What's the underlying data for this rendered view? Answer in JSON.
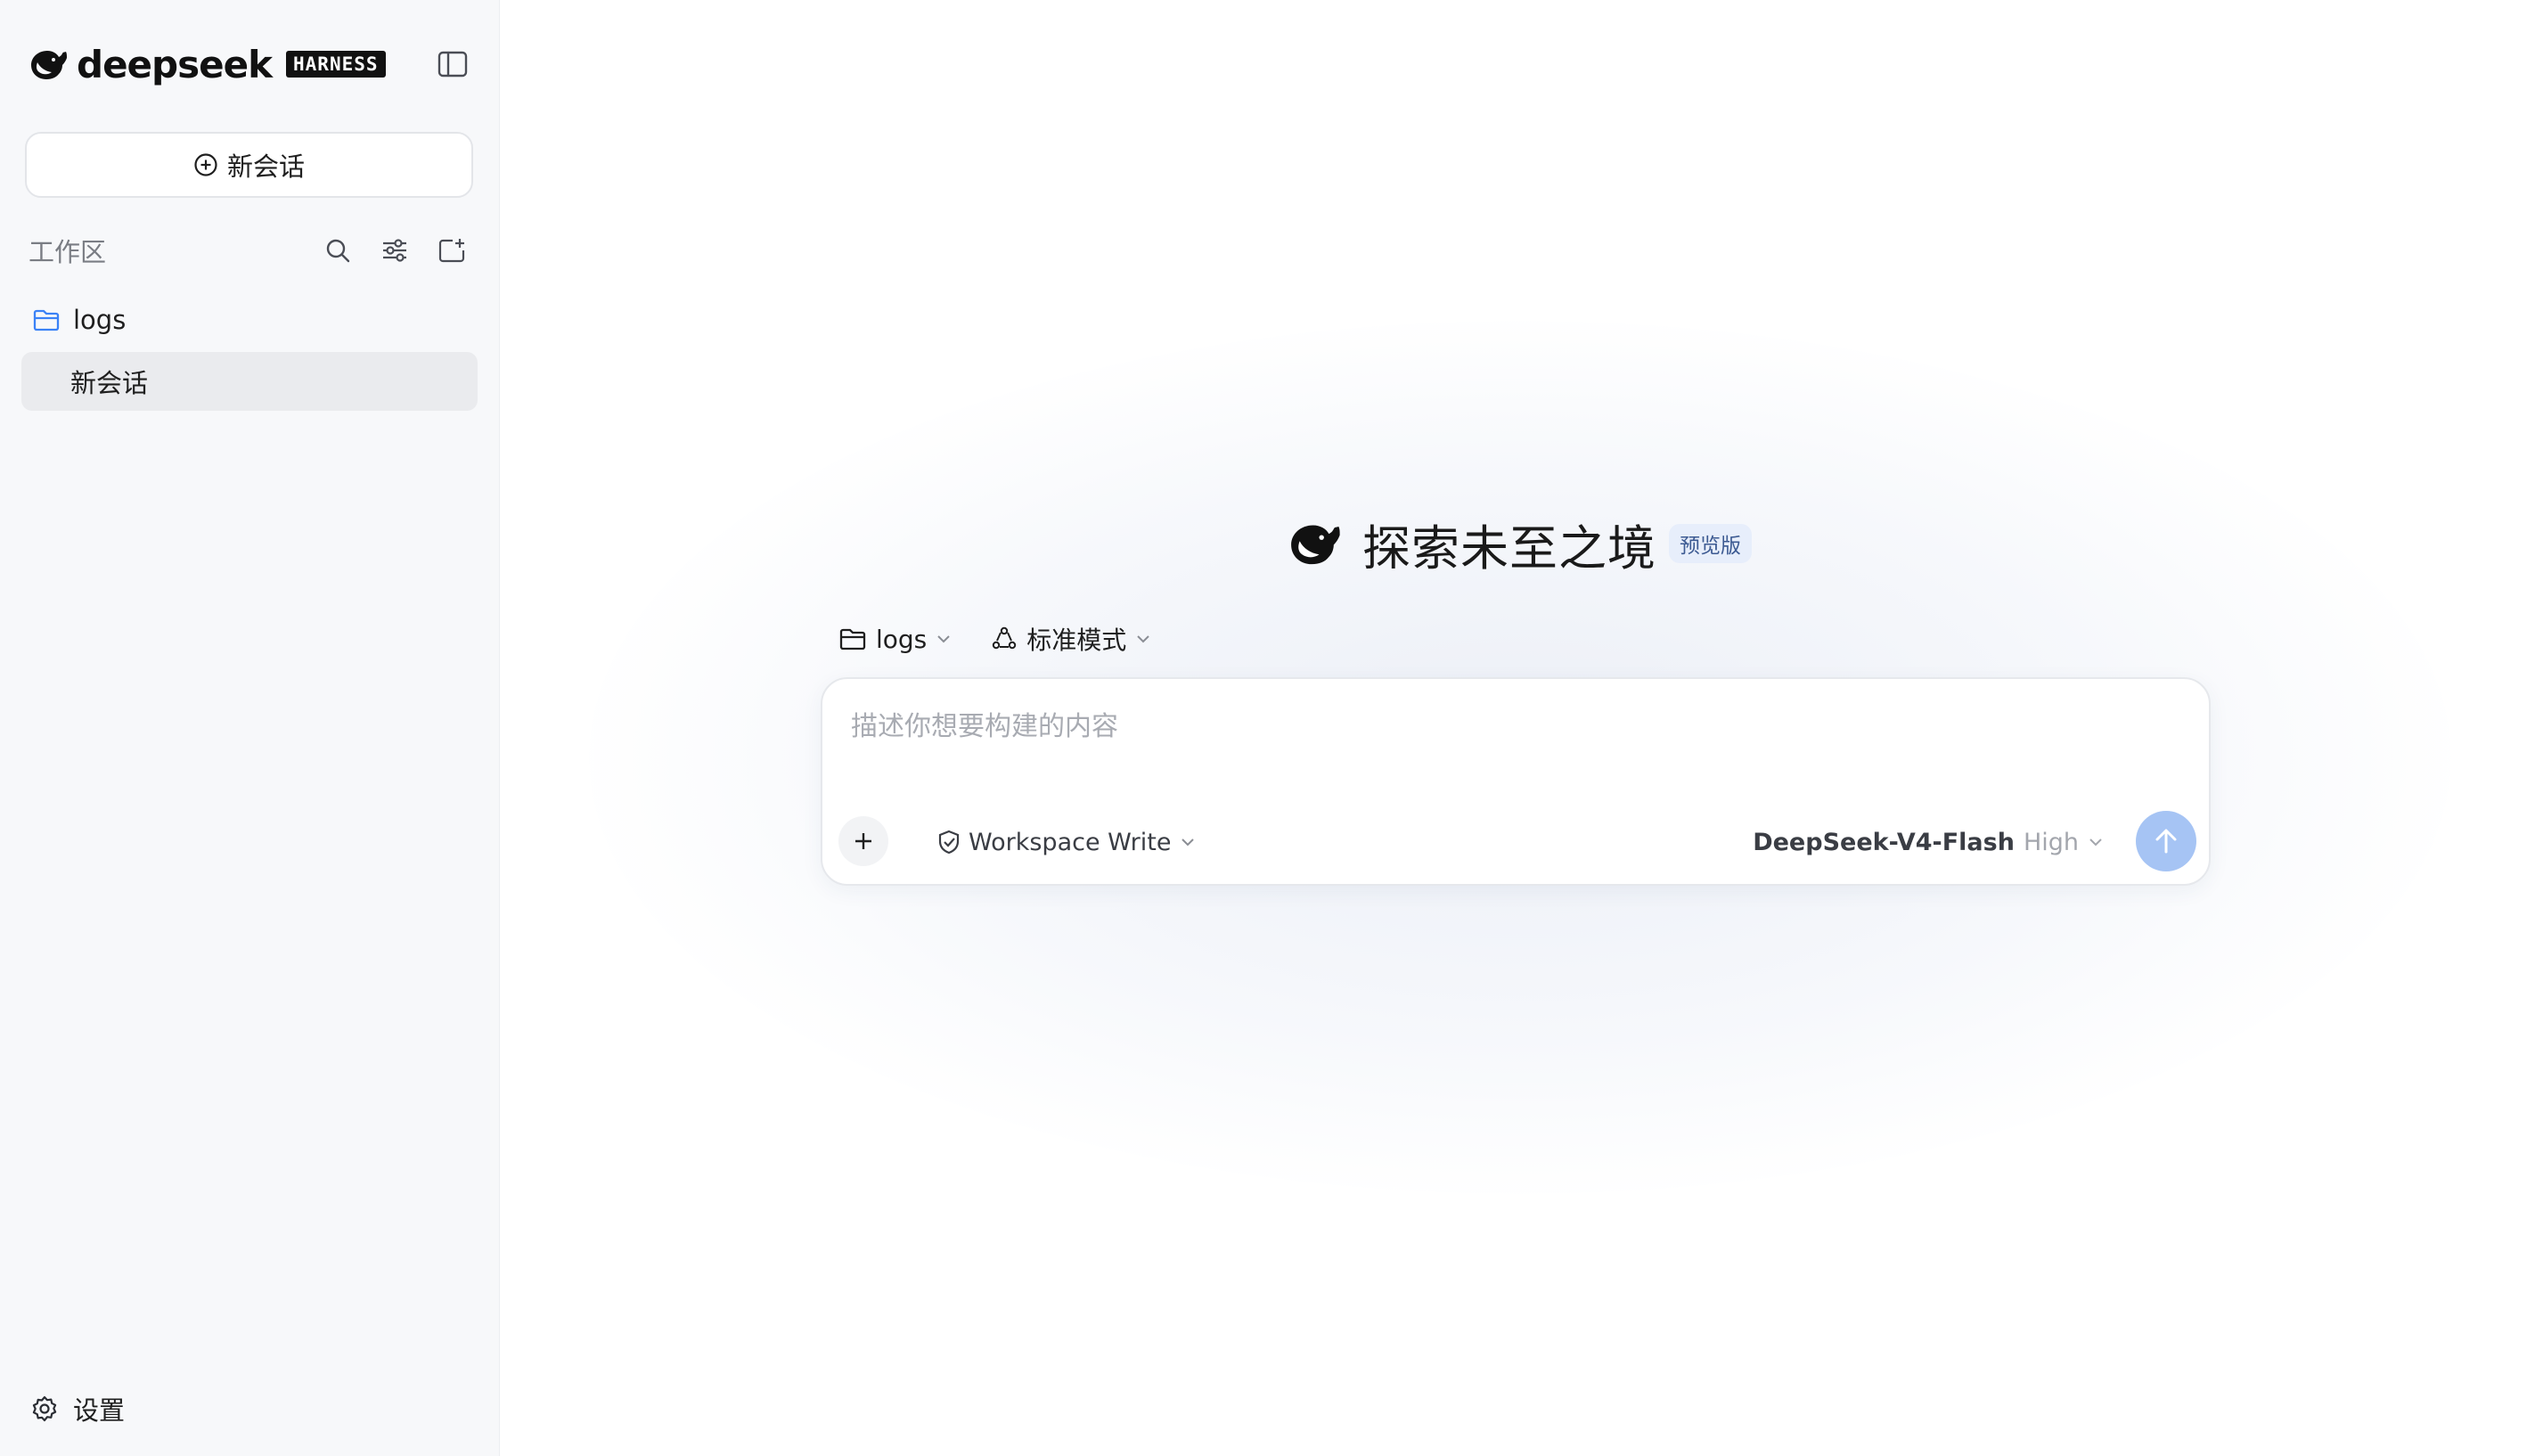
{
  "sidebar": {
    "brand_name": "deepseek",
    "brand_badge": "HARNESS",
    "new_chat_label": "新会话",
    "workspace_label": "工作区",
    "folder": {
      "name": "logs",
      "color": "#3b82f6"
    },
    "chats": [
      {
        "label": "新会话",
        "active": true
      }
    ],
    "settings_label": "设置"
  },
  "main": {
    "hero_title": "探索未至之境",
    "hero_badge": "预览版",
    "project_selector": "logs",
    "mode_selector": "标准模式",
    "composer": {
      "placeholder": "描述你想要构建的内容",
      "value": "",
      "permission_label": "Workspace Write",
      "model_name": "DeepSeek-V4-Flash",
      "model_level": "High"
    }
  },
  "colors": {
    "sidebar_bg": "#f7f8fa",
    "active_item_bg": "#eaebee",
    "send_button": "#a6c4f4",
    "badge_bg": "#e7eefb",
    "badge_text": "#3c5a92"
  },
  "icons": {
    "brand": "whale-logo-icon",
    "collapse": "sidebar-toggle-icon",
    "new_chat": "plus-circle-icon",
    "search": "search-icon",
    "filter": "sliders-icon",
    "new_folder": "folder-plus-icon",
    "folder": "folder-icon",
    "settings": "gear-icon",
    "mode": "cycle-icon",
    "permission": "shield-check-icon",
    "add": "plus-icon",
    "send": "arrow-up-icon",
    "chevron": "chevron-down-icon"
  }
}
